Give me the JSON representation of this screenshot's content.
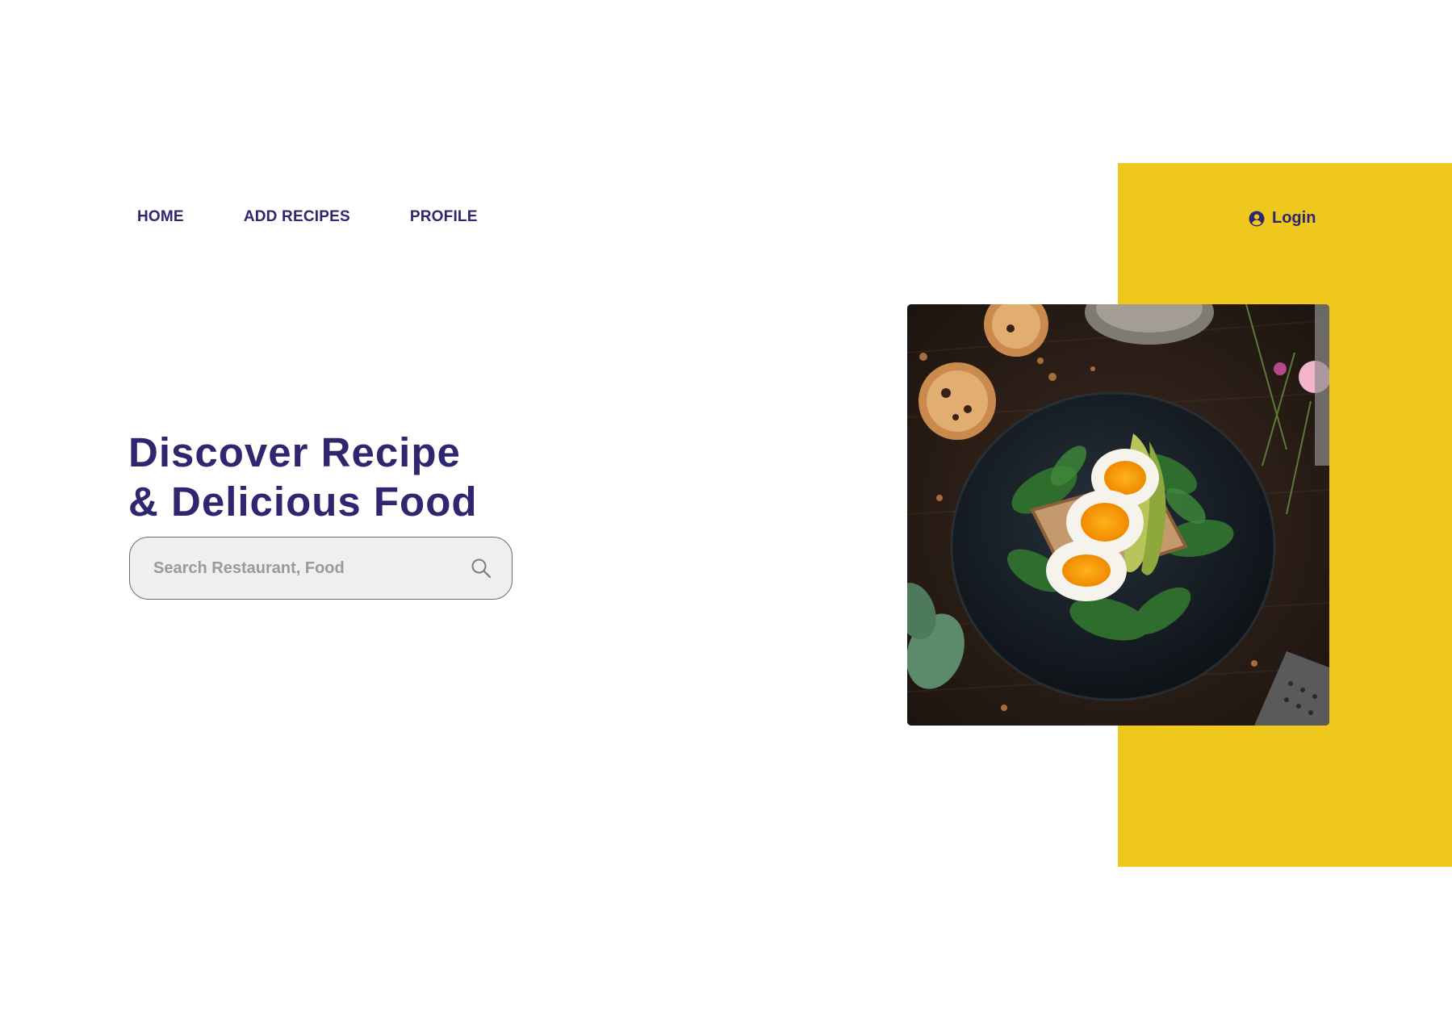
{
  "nav": {
    "items": [
      {
        "label": "HOME"
      },
      {
        "label": "ADD RECIPES"
      },
      {
        "label": "PROFILE"
      }
    ]
  },
  "login": {
    "label": "Login",
    "icon": "user-circle-icon"
  },
  "hero": {
    "headline_line1": "Discover Recipe",
    "headline_line2": "& Delicious Food",
    "image_subject": "egg-avocado-toast-photo"
  },
  "search": {
    "placeholder": "Search Restaurant, Food",
    "value": "",
    "icon": "search-icon"
  },
  "colors": {
    "accent_yellow": "#EFC81E",
    "brand_navy": "#2E266F",
    "search_bg": "#EFEFEF",
    "placeholder": "#9A9A9A"
  }
}
